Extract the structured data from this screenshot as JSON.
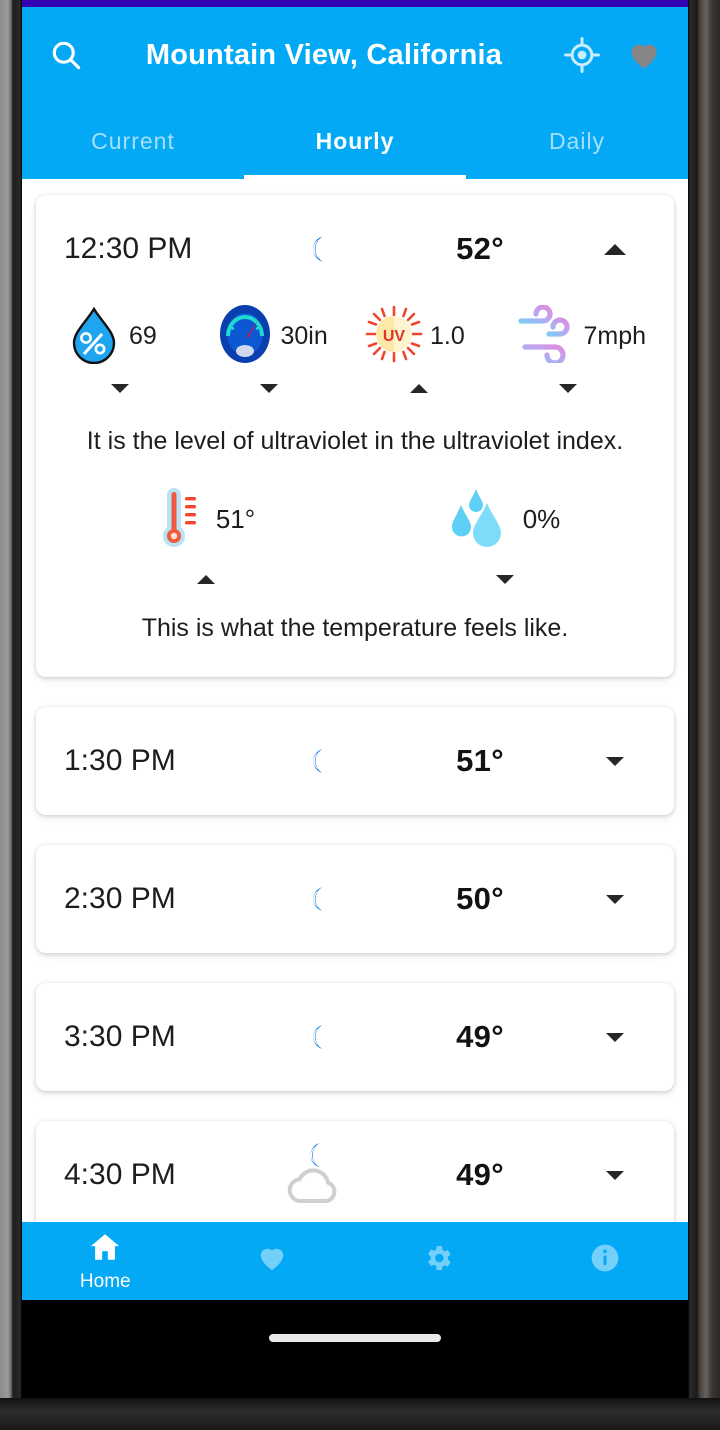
{
  "colors": {
    "status_bar": "#3400b3",
    "app_bar": "#03a9f4",
    "accent": "#03a9f4",
    "card": "#ffffff",
    "moon": "#1478e0",
    "text": "#1d1d1d"
  },
  "status_bar": {
    "label": ""
  },
  "app_bar": {
    "search_icon": "search-icon",
    "title": "Mountain View, California",
    "location_icon": "my-location-icon",
    "favorite_icon": "heart-icon"
  },
  "tabs": [
    {
      "label": "Current",
      "active": false
    },
    {
      "label": "Hourly",
      "active": true
    },
    {
      "label": "Daily",
      "active": false
    }
  ],
  "expanded_hour": {
    "time": "12:30 PM",
    "condition_icon": "crescent-moon-icon",
    "temperature": "52°",
    "collapse_caret": "caret-up-icon",
    "metrics": [
      {
        "icon": "humidity-droplet-icon",
        "value": "69",
        "caret": "caret-down-icon",
        "name": "humidity"
      },
      {
        "icon": "barometer-icon",
        "value": "30in",
        "caret": "caret-down-icon",
        "name": "pressure"
      },
      {
        "icon": "uv-sun-icon",
        "value": "1.0",
        "caret": "caret-up-icon",
        "name": "uv-index"
      },
      {
        "icon": "wind-icon",
        "value": "7mph",
        "caret": "caret-down-icon",
        "name": "wind-speed"
      }
    ],
    "metric_description": "It is the level of ultraviolet in the ultraviolet index.",
    "pairs": [
      {
        "icon": "thermometer-icon",
        "value": "51°",
        "caret": "caret-up-icon",
        "name": "feels-like"
      },
      {
        "icon": "raindrops-icon",
        "value": "0%",
        "caret": "caret-down-icon",
        "name": "precipitation"
      }
    ],
    "pair_description": "This is what the temperature feels like."
  },
  "hours": [
    {
      "time": "1:30 PM",
      "condition_icon": "crescent-moon-icon",
      "cloudy": false,
      "temperature": "51°",
      "caret": "caret-down-icon"
    },
    {
      "time": "2:30 PM",
      "condition_icon": "crescent-moon-icon",
      "cloudy": false,
      "temperature": "50°",
      "caret": "caret-down-icon"
    },
    {
      "time": "3:30 PM",
      "condition_icon": "crescent-moon-icon",
      "cloudy": false,
      "temperature": "49°",
      "caret": "caret-down-icon"
    },
    {
      "time": "4:30 PM",
      "condition_icon": "crescent-moon-cloud-icon",
      "cloudy": true,
      "temperature": "49°",
      "caret": "caret-down-icon"
    }
  ],
  "bottom_nav": [
    {
      "icon": "home-icon",
      "label": "Home",
      "active": true
    },
    {
      "icon": "heart-icon",
      "label": "",
      "active": false
    },
    {
      "icon": "gear-icon",
      "label": "",
      "active": false
    },
    {
      "icon": "info-icon",
      "label": "",
      "active": false
    }
  ]
}
